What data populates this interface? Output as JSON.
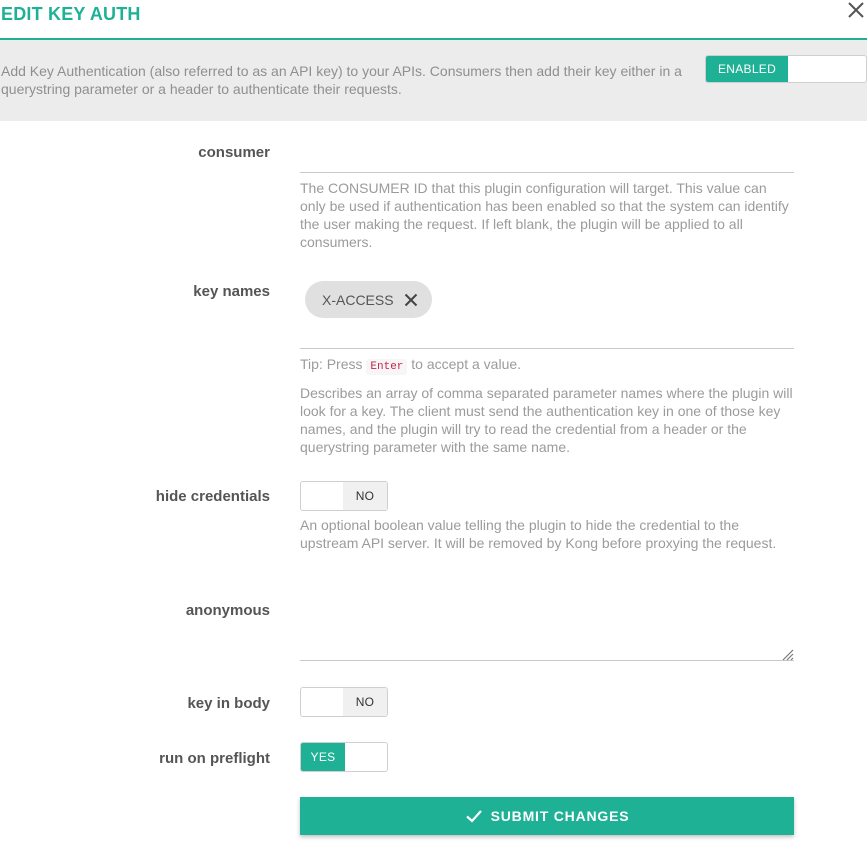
{
  "dialog": {
    "title": "EDIT KEY AUTH",
    "description": "Add Key Authentication (also referred to as an API key) to your APIs. Consumers then add their key either in a querystring parameter or a header to authenticate their requests.",
    "enabled_label": "ENABLED"
  },
  "fields": {
    "consumer": {
      "label": "consumer",
      "value": "",
      "help": "The CONSUMER ID that this plugin configuration will target. This value can only be used if authentication has been enabled so that the system can identify the user making the request. If left blank, the plugin will be applied to all consumers."
    },
    "key_names": {
      "label": "key names",
      "chips": [
        "X-ACCESS"
      ],
      "tip_prefix": "Tip: Press",
      "tip_key": "Enter",
      "tip_suffix": "to accept a value.",
      "help": "Describes an array of comma separated parameter names where the plugin will look for a key. The client must send the authentication key in one of those key names, and the plugin will try to read the credential from a header or the querystring parameter with the same name."
    },
    "hide_credentials": {
      "label": "hide credentials",
      "value": "NO",
      "help": "An optional boolean value telling the plugin to hide the credential to the upstream API server. It will be removed by Kong before proxying the request."
    },
    "anonymous": {
      "label": "anonymous",
      "value": ""
    },
    "key_in_body": {
      "label": "key in body",
      "value": "NO"
    },
    "run_on_preflight": {
      "label": "run on preflight",
      "value": "YES"
    }
  },
  "submit_label": "SUBMIT CHANGES",
  "colors": {
    "accent": "#1fb196",
    "info_bg": "#ececec",
    "chip_bg": "#e0e0e0"
  },
  "icons": {
    "close": "close-icon",
    "chip_remove": "close-icon",
    "submit": "check-icon"
  }
}
